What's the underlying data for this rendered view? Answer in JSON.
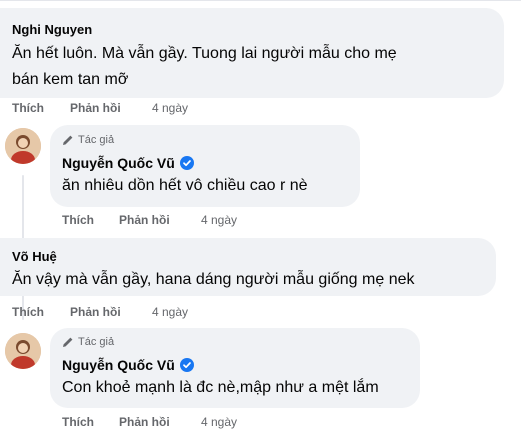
{
  "comments": [
    {
      "author": "Nghi Nguyen",
      "line1": "Ăn hết luôn. Mà vẫn gầy. Tuong lai người mẫu cho mẹ",
      "line2": "bán kem tan mỡ",
      "like": "Thích",
      "reply": "Phản hồi",
      "time": "4 ngày"
    },
    {
      "author": "Nguyễn Quốc Vũ",
      "badge": "Tác giả",
      "line1": "ăn nhiêu dồn hết vô chiều cao r nè",
      "like": "Thích",
      "reply": "Phản hồi",
      "time": "4 ngày"
    },
    {
      "author": "Võ Huệ",
      "line1": "Ăn vậy mà vẫn gầy, hana dáng người mẫu giống mẹ nek",
      "like": "Thích",
      "reply": "Phản hồi",
      "time": "4 ngày"
    },
    {
      "author": "Nguyễn Quốc Vũ",
      "badge": "Tác giả",
      "line1": "Con khoẻ mạnh là đc nè,mập như a mệt lắm",
      "like": "Thích",
      "reply": "Phản hồi",
      "time": "4 ngày"
    }
  ],
  "icons": {
    "author_badge": "pencil-icon",
    "verified": "verified-badge-icon",
    "verified_color": "#1877f2"
  },
  "colors": {
    "bubble": "#f0f2f5",
    "secondary_text": "#65676b",
    "primary_text": "#050505"
  }
}
